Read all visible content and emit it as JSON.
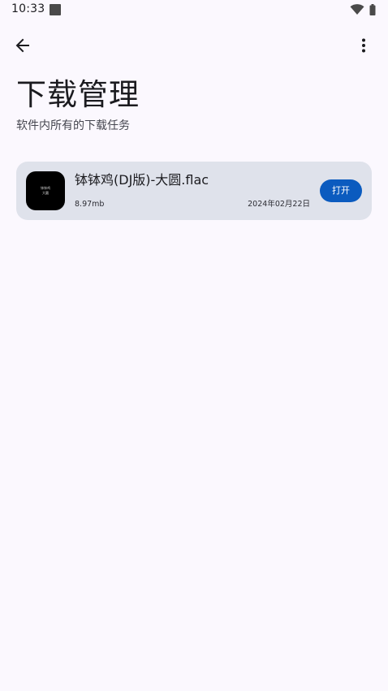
{
  "status_bar": {
    "time": "10:33"
  },
  "icons": {
    "back": "arrow-back-icon",
    "more": "more-vertical-icon",
    "wifi": "wifi-icon",
    "battery": "battery-icon",
    "notification": "notification-square-icon"
  },
  "header": {
    "title": "下载管理",
    "subtitle": "软件内所有的下载任务"
  },
  "downloads": [
    {
      "thumbnail_text_line1": "钵钵鸡",
      "thumbnail_text_line2": "大圆",
      "name": "钵钵鸡(DJ版)-大圆.flac",
      "size": "8.97mb",
      "date": "2024年02月22日",
      "action_label": "打开"
    }
  ],
  "colors": {
    "background": "#fbf8fe",
    "card": "#dfe2eb",
    "accent": "#0b5bbf"
  }
}
